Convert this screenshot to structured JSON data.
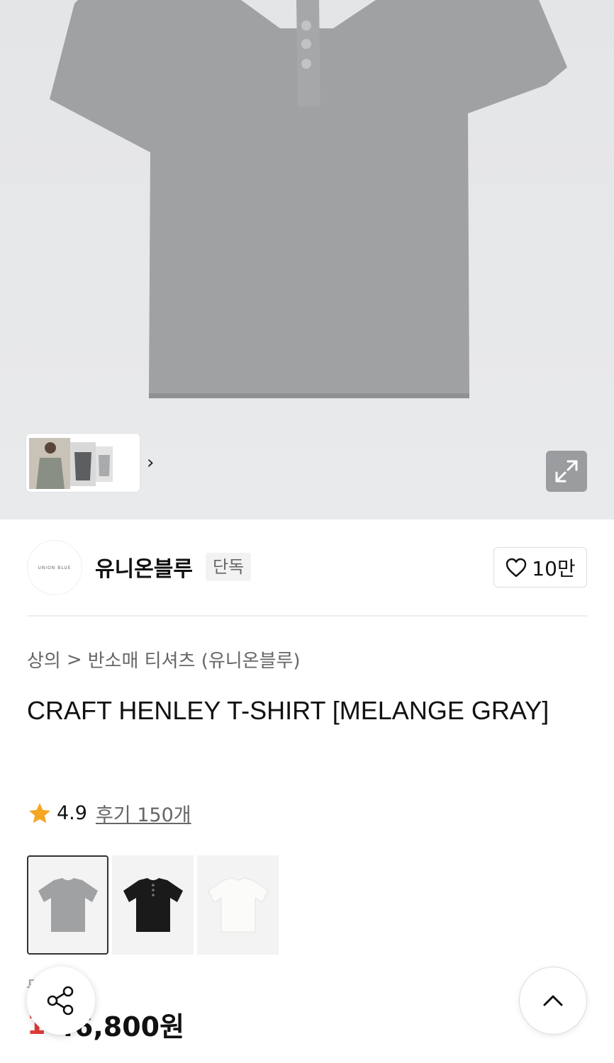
{
  "gallery": {
    "more_chevron": "›"
  },
  "brand": {
    "logo_text": "UNION BLUE",
    "name": "유니온블루",
    "exclusive_badge": "단독",
    "like_count": "10만"
  },
  "breadcrumb": {
    "category": "상의",
    "separator": ">",
    "subcategory": "반소매 티셔츠 (유니온블루)"
  },
  "product": {
    "title": "CRAFT HENLEY T-SHIRT [MELANGE GRAY]",
    "rating": "4.9",
    "reviews_label": "후기 150개",
    "original_price": "5 9원",
    "discount": "1",
    "price": "46,800원"
  },
  "colors": {
    "star": "#f5a623",
    "discount": "#e23b3b"
  },
  "swatches": [
    {
      "name": "melange-gray",
      "color": "#9fa1a3"
    },
    {
      "name": "black",
      "color": "#1a1a1a"
    },
    {
      "name": "white",
      "color": "#f0f0ee"
    }
  ],
  "icons": {
    "share": "share-icon",
    "top": "chevron-up-icon",
    "expand": "expand-icon",
    "heart": "heart-icon",
    "star": "star-icon"
  }
}
